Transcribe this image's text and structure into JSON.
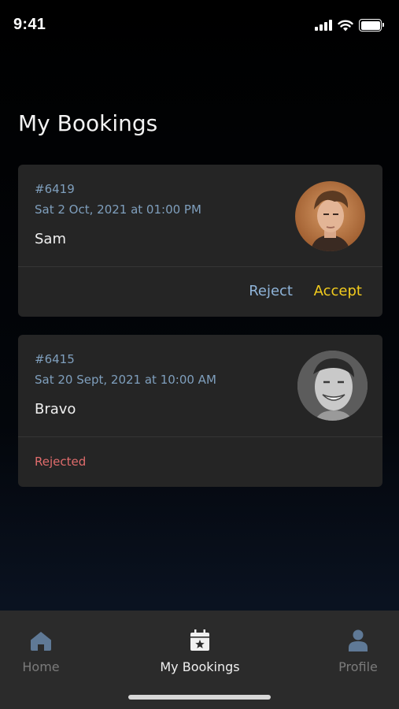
{
  "status_bar": {
    "time": "9:41"
  },
  "page": {
    "title": "My Bookings"
  },
  "bookings": [
    {
      "id": "#6419",
      "datetime": "Sat 2 Oct, 2021 at 01:00 PM",
      "name": "Sam",
      "actions": {
        "reject": "Reject",
        "accept": "Accept"
      }
    },
    {
      "id": "#6415",
      "datetime": "Sat 20 Sept, 2021 at 10:00 AM",
      "name": "Bravo",
      "status": "Rejected"
    }
  ],
  "tab_bar": {
    "items": [
      {
        "label": "Home",
        "icon": "home-icon"
      },
      {
        "label": "My Bookings",
        "icon": "calendar-star-icon",
        "active": true
      },
      {
        "label": "Profile",
        "icon": "person-icon"
      }
    ]
  },
  "colors": {
    "background": "#000000",
    "card": "#252525",
    "meta_text": "#7f9fbd",
    "accept": "#f3cc1d",
    "reject": "#8fb4d9",
    "rejected_status": "#e06c6c",
    "tab_inactive": "#7b7b7b",
    "tab_icon_inactive": "#5f7996"
  }
}
